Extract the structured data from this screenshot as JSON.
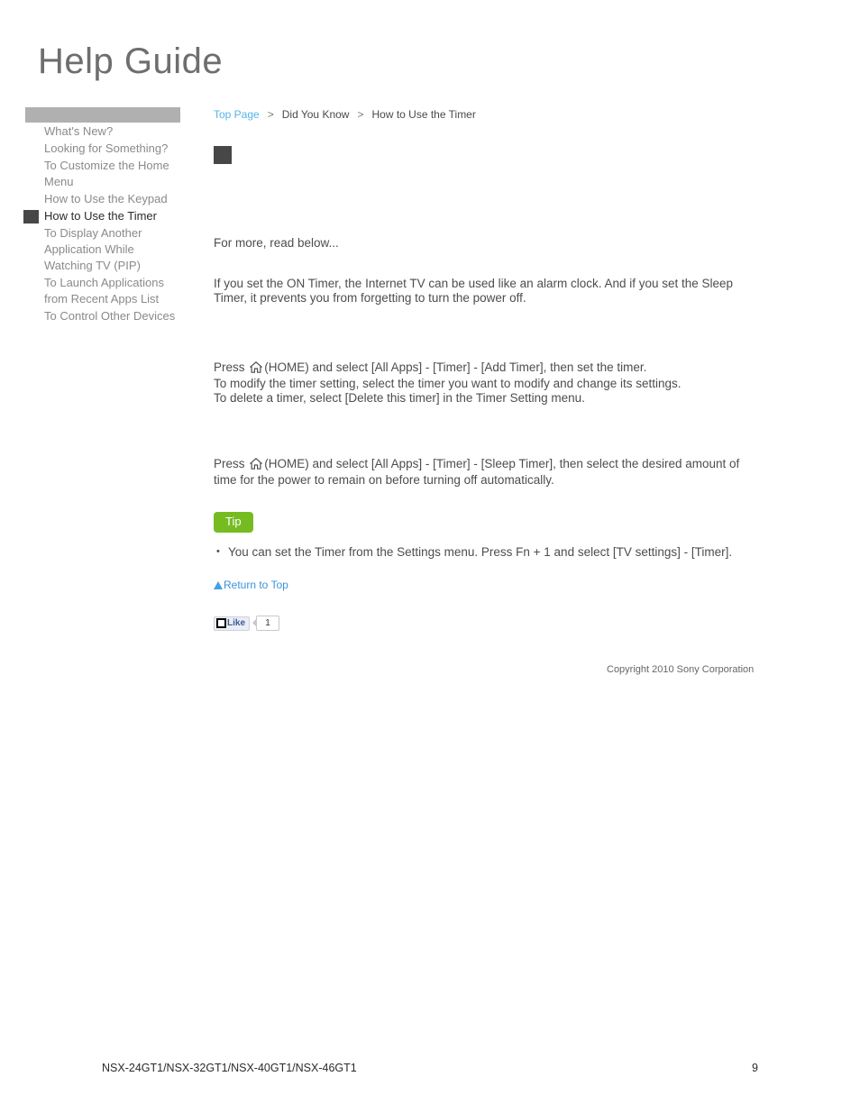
{
  "site": {
    "logo_text": "Help Guide"
  },
  "sidebar": {
    "items": [
      {
        "label": "What's New?",
        "active": false
      },
      {
        "label": "Looking for Something?",
        "active": false
      },
      {
        "label": "To Customize the Home Menu",
        "active": false
      },
      {
        "label": "How to Use the Keypad",
        "active": false
      },
      {
        "label": "How to Use the Timer",
        "active": true
      },
      {
        "label": "To Display Another Application While Watching TV (PIP)",
        "active": false
      },
      {
        "label": "To Launch Applications from Recent Apps List",
        "active": false
      },
      {
        "label": "To Control Other Devices",
        "active": false
      }
    ]
  },
  "breadcrumb": {
    "top_page": "Top Page",
    "separator": ">",
    "section": "Did You Know",
    "current": "How to Use the Timer"
  },
  "main": {
    "lead": "For more, read below...",
    "intro": "If you set the ON Timer, the Internet TV can be used like an alarm clock. And if you set the Sleep Timer, it prevents you from forgetting to turn the power off.",
    "on_timer": {
      "line1_before_icon": "Press",
      "home_icon": "home-icon",
      "line1_after_icon": "(HOME) and select [All Apps] - [Timer] - [Add Timer], then set the timer.",
      "line2": "To modify the timer setting, select the timer you want to modify and change its settings.",
      "line3": "To delete a timer, select [Delete this timer] in the Timer Setting menu."
    },
    "sleep_timer": {
      "line1_before_icon": "Press",
      "home_icon": "home-icon",
      "line1_after_icon": "(HOME) and select [All Apps] - [Timer] - [Sleep Timer], then select the desired amount of time for the power to remain on before turning off automatically."
    },
    "tip": {
      "badge": "Tip",
      "items": [
        "You can set the Timer from the Settings menu. Press Fn + 1 and select [TV settings] - [Timer]."
      ]
    },
    "return_to_top": "Return to Top",
    "like_widget": {
      "label": "Like",
      "count": "1"
    }
  },
  "footer": {
    "copyright": "Copyright 2010 Sony Corporation",
    "models": "NSX-24GT1/NSX-32GT1/NSX-40GT1/NSX-46GT1",
    "page_number": "9"
  },
  "colors": {
    "breadcrumb_link": "#55b4e8",
    "tip_badge_bg": "#76bc21",
    "sidebar_header_bar": "#b0b0b0",
    "marker_dark": "#474747",
    "return_top_link": "#3c93d8",
    "like_label": "#3b5998"
  }
}
